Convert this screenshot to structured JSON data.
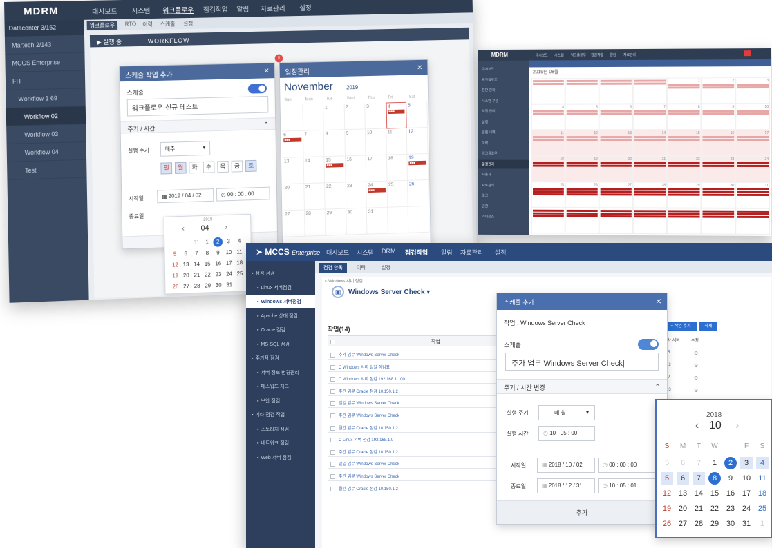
{
  "screenA": {
    "logo": "MDRM",
    "nav": [
      "대시보드",
      "시스템",
      "워크플로우",
      "점검작업",
      "알림",
      "자료관리",
      "설정"
    ],
    "sidebar_head": "Datacenter  3/162",
    "sidebar_items": [
      "Martech  2/143",
      "MCCS Enterprise",
      "FIT  ",
      "Workflow 1  69",
      "Workflow 02",
      "Workflow 03",
      "Workflow 04",
      "Test"
    ],
    "subtabs": [
      "워크플로우",
      "RTO",
      "이력",
      "스케줄",
      "설정"
    ],
    "wf_bar_left": "▶  실행 중",
    "wf_bar_title": "WORKFLOW",
    "modal": {
      "title": "스케줄 작업 추가",
      "schedule_label": "스케줄",
      "name_value": "워크플로우-신규 테스트",
      "section_label": "주기 / 시간",
      "cycle_label": "실행 주기",
      "cycle_value": "매주",
      "days": [
        "일",
        "월",
        "화",
        "수",
        "목",
        "금",
        "토"
      ],
      "start_label": "시작일",
      "start_date": "2019 / 04 / 02",
      "start_time": "00 : 00 : 00",
      "end_label": "종료일"
    },
    "mini_picker": {
      "year": "2019",
      "month": "04",
      "weeks": [
        [
          "31",
          "1",
          "2",
          "3",
          "4"
        ],
        [
          "5",
          "6",
          "7",
          "8",
          "9",
          "10",
          "11"
        ],
        [
          "12",
          "13",
          "14",
          "15",
          "16",
          "17",
          "18"
        ],
        [
          "19",
          "20",
          "21",
          "22",
          "23",
          "24",
          "25"
        ],
        [
          "26",
          "27",
          "28",
          "29",
          "30",
          "31"
        ]
      ]
    },
    "calendar": {
      "title": "일정관리",
      "month": "November",
      "year": "2019",
      "dows": [
        "Sun",
        "Mon",
        "Tue",
        "Wed",
        "Thu",
        "Fri",
        "Sat"
      ],
      "rows": [
        [
          "",
          "",
          "",
          "",
          "",
          "",
          ""
        ],
        [
          "",
          "",
          "1",
          "2",
          "3",
          "4",
          "5"
        ],
        [
          "6",
          "7",
          "8",
          "9",
          "10",
          "11",
          "12"
        ],
        [
          "13",
          "14",
          "15",
          "16",
          "17",
          "18",
          "19"
        ],
        [
          "20",
          "21",
          "22",
          "23",
          "24",
          "25",
          "26"
        ],
        [
          "27",
          "28",
          "29",
          "30",
          "31",
          "",
          ""
        ]
      ]
    }
  },
  "screenB": {
    "logo": "MDRM",
    "nav": [
      "대시보드",
      "시스템",
      "워크플로우",
      "점검작업",
      "알림",
      "자료관리"
    ],
    "menu": [
      "대시보드",
      "워크플로우",
      "진단 관리",
      "시스템 구성",
      "작업 관리",
      "설정",
      "알림 내역",
      "이력",
      "워크플로우",
      "일정관리",
      "사용자",
      "자료관리",
      "로그",
      "권한",
      "라이선스"
    ],
    "title": "2019년 08월"
  },
  "screenC": {
    "logo": "MCCS",
    "logo_sub": "Enterprise",
    "nav": [
      "대시보드",
      "시스템",
      "DRM",
      "점검작업",
      "알림",
      "자료관리",
      "설정"
    ],
    "nav_active_index": 3,
    "tabs": [
      "점검 항목",
      "이력",
      "설정"
    ],
    "breadcrumb": "< Windows 서버 점검",
    "page_title": "Windows Server Check",
    "list_title": "작업(14)",
    "col_header": "작업",
    "sidebar": [
      {
        "label": "점검 점검",
        "sub": false
      },
      {
        "label": "Linux 서버점검",
        "sub": true
      },
      {
        "label": "Windows 서버점검",
        "sub": true,
        "active": true
      },
      {
        "label": "Apache 상태 점검",
        "sub": true
      },
      {
        "label": "Oracle 점검",
        "sub": true
      },
      {
        "label": "MS-SQL 점검",
        "sub": true
      },
      {
        "label": "주기적 점검",
        "sub": false
      },
      {
        "label": "서버 정보 변경관리",
        "sub": true
      },
      {
        "label": "패스워드 체크",
        "sub": true
      },
      {
        "label": "보안 점검",
        "sub": true
      },
      {
        "label": "기타 점검 작업",
        "sub": false
      },
      {
        "label": "스토리지 점검",
        "sub": true
      },
      {
        "label": "네트워크 점검",
        "sub": true
      },
      {
        "label": "Web 서버 점검",
        "sub": true
      }
    ],
    "rows": [
      "추가 업무 Windows Server Check",
      "C  Windows 서버 일일 점검표",
      "C  Windows 서버 점검 192.168.1.100",
      "주간 업무 Oracle 점검 10.150.1.2",
      "일일 업무 Windows Server Check",
      "주간 업무 Windows Server Check",
      "월간 업무 Oracle 점검 10.150.1.2",
      "C  Linux 서버 점검 192.168.1.0",
      "주간 업무 Oracle 점검 10.150.1.2",
      "일일 업무 Windows Server Check",
      "주간 업무 Windows Server Check",
      "월간 업무 Oracle 점검 10.150.1.2"
    ],
    "right_buttons": [
      "+ 작업 추가",
      "삭제"
    ],
    "right_cols": [
      "대상 서버",
      "수정"
    ],
    "right_vals": [
      "5",
      "12",
      "2",
      "23"
    ]
  },
  "modal": {
    "title": "스케줄 추가",
    "job_label": "작업 :  Windows Server Check",
    "schedule_label": "스케줄",
    "name_value": "추가 업무 Windows Server Check|",
    "section_label": "주기 / 시간 변경",
    "cycle_label": "실행 주기",
    "cycle_value": "매 월",
    "time_label": "실행 시간",
    "time_value": "10 : 05 : 00",
    "start_label": "시작일",
    "start_date": "2018 / 10 / 02",
    "start_time": "00 : 00 : 00",
    "end_label": "종료일",
    "end_date": "2018 / 12 / 31",
    "end_time": "10 : 05 : 01",
    "submit": "추가"
  },
  "datepicker": {
    "year": "2018",
    "month": "10",
    "dows": [
      "S",
      "M",
      "T",
      "W",
      "",
      "F",
      "S"
    ],
    "weeks": [
      [
        "5",
        "6",
        "7",
        "1",
        "2",
        "3",
        "4"
      ],
      [
        "5",
        "6",
        "7",
        "8",
        "9",
        "10",
        "11"
      ],
      [
        "12",
        "13",
        "14",
        "15",
        "16",
        "17",
        "18"
      ],
      [
        "19",
        "20",
        "21",
        "22",
        "23",
        "24",
        "25"
      ],
      [
        "26",
        "27",
        "28",
        "29",
        "30",
        "31",
        "1"
      ]
    ]
  },
  "colors": {
    "navy": "#2f3d52",
    "accent": "#2c6fd1",
    "event_red": "#c0392b"
  }
}
